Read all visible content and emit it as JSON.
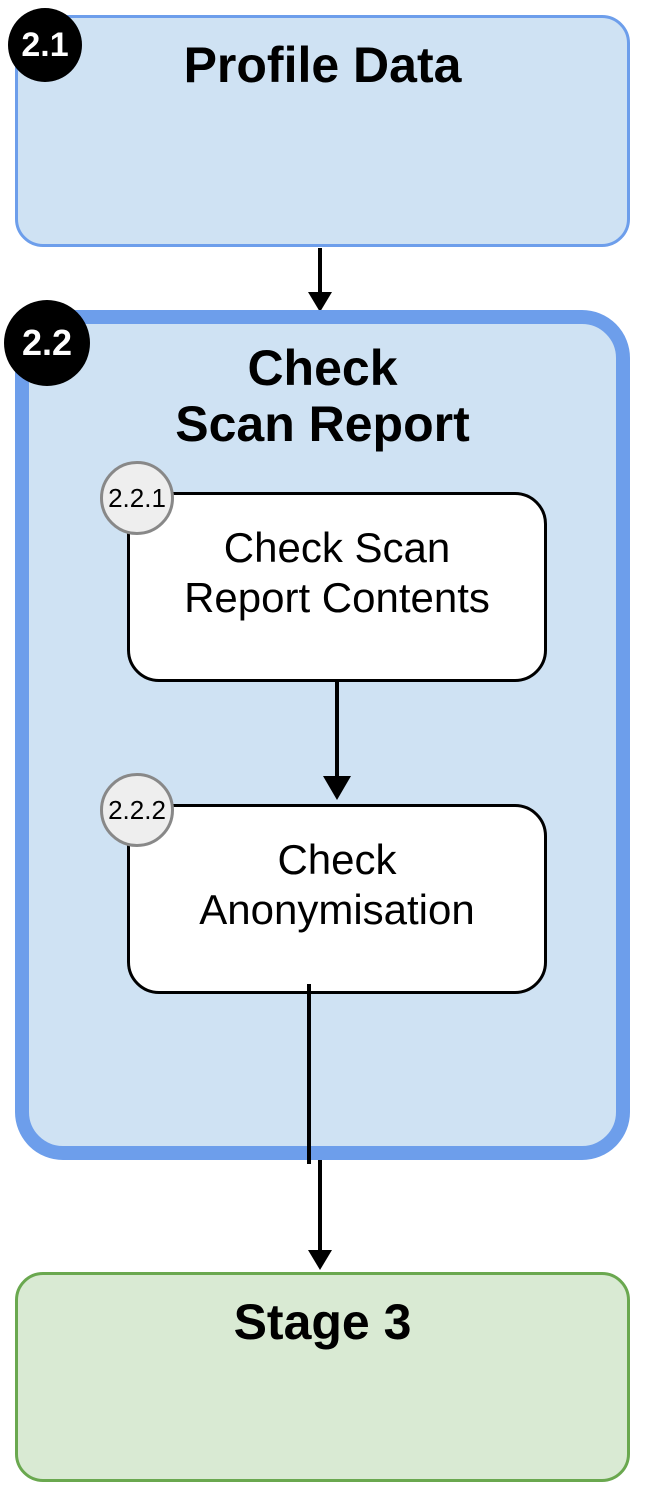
{
  "diagram": {
    "nodes": {
      "n21": {
        "badge": "2.1",
        "title": "Profile Data"
      },
      "n22": {
        "badge": "2.2",
        "title_line1": "Check",
        "title_line2": "Scan Report",
        "children": {
          "n221": {
            "badge": "2.2.1",
            "text_line1": "Check Scan",
            "text_line2": "Report Contents"
          },
          "n222": {
            "badge": "2.2.2",
            "text_line1": "Check",
            "text_line2": "Anonymisation"
          }
        }
      },
      "stage3": {
        "title": "Stage 3"
      }
    },
    "edges": [
      {
        "from": "2.1",
        "to": "2.2"
      },
      {
        "from": "2.2.1",
        "to": "2.2.2"
      },
      {
        "from": "2.2",
        "to": "Stage 3"
      }
    ],
    "colors": {
      "blue_fill": "#cfe2f3",
      "blue_border": "#6d9eeb",
      "green_fill": "#d9ead3",
      "green_border": "#6aa84f",
      "badge_black": "#000000",
      "badge_grey_fill": "#eeeeee",
      "badge_grey_border": "#888888"
    }
  }
}
